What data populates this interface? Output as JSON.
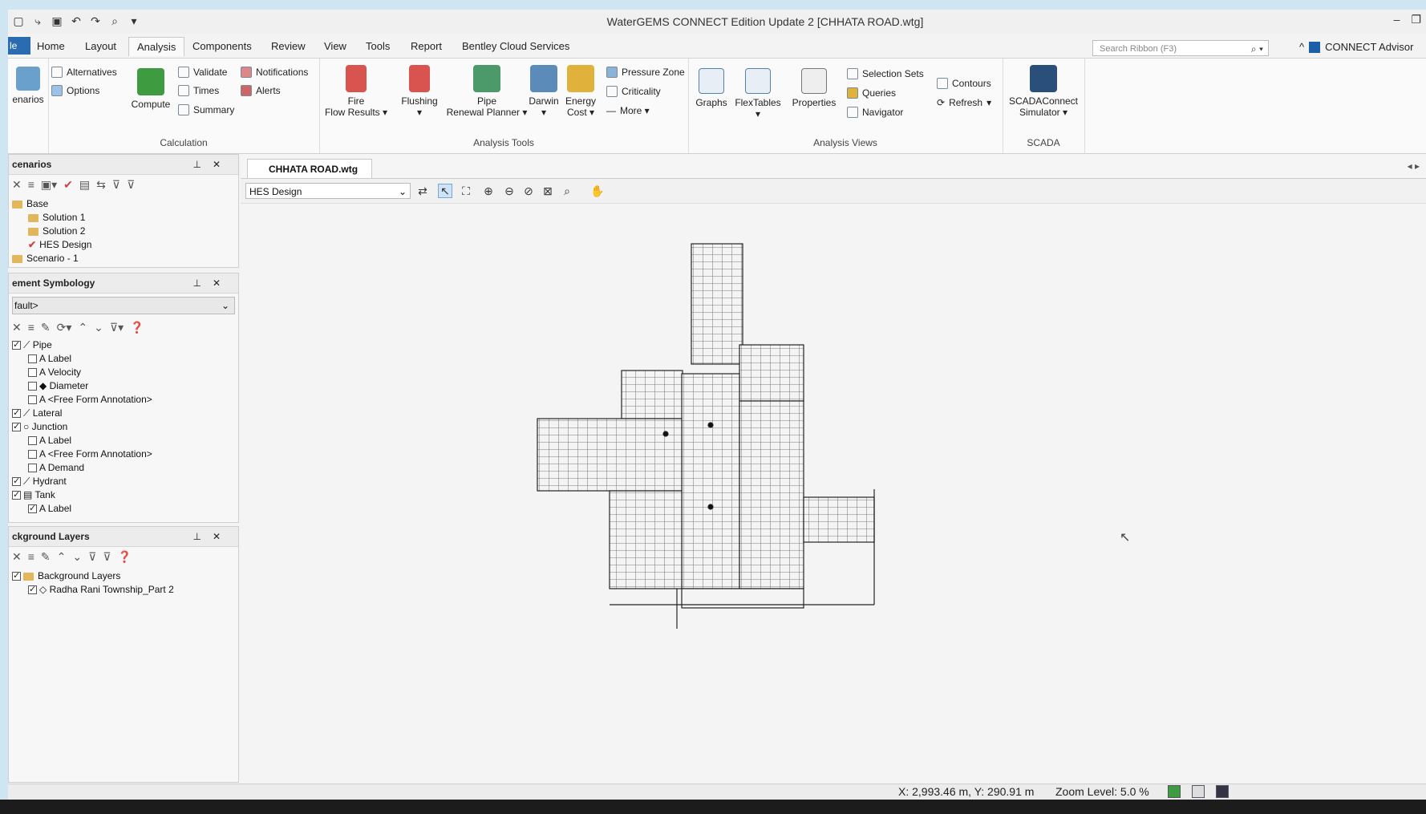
{
  "window": {
    "title": "WaterGEMS CONNECT Edition Update 2 [CHHATA ROAD.wtg]"
  },
  "quick_access": [
    "new-icon",
    "open-icon",
    "save-icon",
    "undo-icon",
    "redo-icon",
    "find-icon",
    "customize-icon"
  ],
  "tabs": {
    "file": "le",
    "items": [
      "Home",
      "Layout",
      "Analysis",
      "Components",
      "Review",
      "View",
      "Tools",
      "Report",
      "Bentley Cloud Services"
    ],
    "active": "Analysis"
  },
  "search": {
    "placeholder": "Search Ribbon (F3)"
  },
  "connect_label": "CONNECT Advisor",
  "ribbon": {
    "scenarios_label": "enarios",
    "calculation": {
      "label": "Calculation",
      "alternatives": "Alternatives",
      "options": "Options",
      "compute": "Compute",
      "validate": "Validate",
      "times": "Times",
      "summary": "Summary",
      "notifications": "Notifications",
      "alerts": "Alerts"
    },
    "analysis_tools": {
      "label": "Analysis Tools",
      "fire_flow": [
        "Fire",
        "Flow Results ▾"
      ],
      "flushing": "Flushing",
      "pipe_renewal": [
        "Pipe",
        "Renewal Planner ▾"
      ],
      "darwin": "Darwin",
      "energy_cost": [
        "Energy",
        "Cost ▾"
      ],
      "pressure_zone": "Pressure Zone",
      "criticality": "Criticality",
      "more": "More ▾"
    },
    "analysis_views": {
      "label": "Analysis Views",
      "graphs": "Graphs",
      "flextables": "FlexTables",
      "properties": "Properties",
      "selection_sets": "Selection Sets",
      "queries": "Queries",
      "navigator": "Navigator",
      "contours": "Contours",
      "refresh": "Refresh"
    },
    "scada": {
      "label": "SCADA",
      "simulator": [
        "SCADAConnect",
        "Simulator ▾"
      ]
    }
  },
  "scenarios_panel": {
    "title": "cenarios",
    "items": [
      {
        "label": "Base",
        "level": 0
      },
      {
        "label": "Solution 1",
        "level": 1
      },
      {
        "label": "Solution 2",
        "level": 1
      },
      {
        "label": "HES Design",
        "level": 1,
        "active": true
      },
      {
        "label": "Scenario - 1",
        "level": 0
      }
    ]
  },
  "symbology_panel": {
    "title": "ement Symbology",
    "dropdown": "fault>",
    "items": [
      {
        "label": "Pipe",
        "level": 0,
        "checked": true
      },
      {
        "label": "Label",
        "level": 1
      },
      {
        "label": "Velocity",
        "level": 1
      },
      {
        "label": "Diameter",
        "level": 1
      },
      {
        "label": "<Free Form Annotation>",
        "level": 1
      },
      {
        "label": "Lateral",
        "level": 0,
        "checked": true
      },
      {
        "label": "Junction",
        "level": 0,
        "checked": true
      },
      {
        "label": "Label",
        "level": 1
      },
      {
        "label": "<Free Form Annotation>",
        "level": 1
      },
      {
        "label": "Demand",
        "level": 1
      },
      {
        "label": "Hydrant",
        "level": 0,
        "checked": true
      },
      {
        "label": "Tank",
        "level": 0,
        "checked": true
      },
      {
        "label": "Label",
        "level": 1,
        "checked": true
      }
    ]
  },
  "background_panel": {
    "title": "ckground Layers",
    "items": [
      {
        "label": "Background Layers",
        "level": 0,
        "checked": true
      },
      {
        "label": "Radha Rani Township_Part 2",
        "level": 1,
        "checked": true
      }
    ]
  },
  "document": {
    "tab": "CHHATA ROAD.wtg",
    "scenario": "HES Design"
  },
  "status": {
    "coords": "X: 2,993.46 m, Y: 290.91 m",
    "zoom": "Zoom Level: 5.0 %"
  }
}
